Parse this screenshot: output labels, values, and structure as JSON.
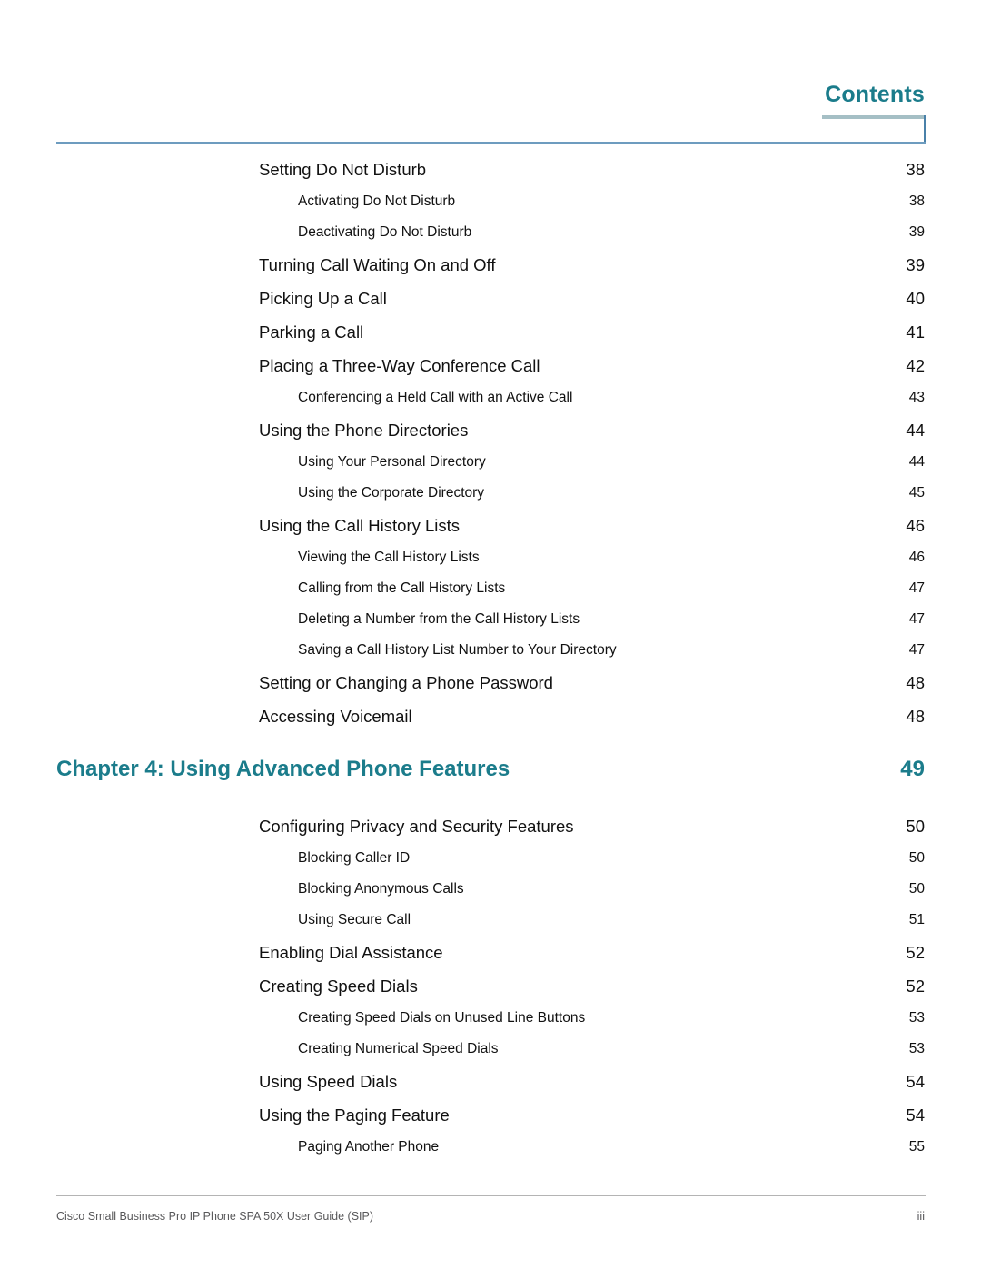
{
  "header": {
    "title": "Contents",
    "accent_color": "#1b7c8b",
    "rule_color": "#6d9cbf",
    "underline_color": "#a5bfc5"
  },
  "toc": {
    "entries": [
      {
        "level": 1,
        "label": "Setting Do Not Disturb",
        "page": "38"
      },
      {
        "level": 2,
        "label": "Activating Do Not Disturb",
        "page": "38"
      },
      {
        "level": 2,
        "label": "Deactivating Do Not Disturb",
        "page": "39"
      },
      {
        "level": 1,
        "label": "Turning Call Waiting On and Off",
        "page": "39"
      },
      {
        "level": 1,
        "label": "Picking Up a Call",
        "page": "40"
      },
      {
        "level": 1,
        "label": "Parking a Call",
        "page": "41"
      },
      {
        "level": 1,
        "label": "Placing a Three-Way Conference Call",
        "page": "42"
      },
      {
        "level": 2,
        "label": "Conferencing a Held Call with an Active Call",
        "page": "43"
      },
      {
        "level": 1,
        "label": "Using the Phone Directories",
        "page": "44"
      },
      {
        "level": 2,
        "label": "Using Your Personal Directory",
        "page": "44"
      },
      {
        "level": 2,
        "label": "Using the Corporate Directory",
        "page": "45"
      },
      {
        "level": 1,
        "label": "Using the Call History Lists",
        "page": "46"
      },
      {
        "level": 2,
        "label": "Viewing the Call History Lists",
        "page": "46"
      },
      {
        "level": 2,
        "label": "Calling from the Call History Lists",
        "page": "47"
      },
      {
        "level": 2,
        "label": "Deleting a Number from the Call History Lists",
        "page": "47"
      },
      {
        "level": 2,
        "label": "Saving a Call History List Number to Your Directory",
        "page": "47"
      },
      {
        "level": 1,
        "label": "Setting or Changing a Phone Password",
        "page": "48"
      },
      {
        "level": 1,
        "label": "Accessing Voicemail",
        "page": "48"
      },
      {
        "level": "chapter",
        "label": "Chapter 4: Using Advanced Phone Features",
        "page": "49"
      },
      {
        "level": 1,
        "label": "Configuring Privacy and Security Features",
        "page": "50"
      },
      {
        "level": 2,
        "label": "Blocking Caller ID",
        "page": "50"
      },
      {
        "level": 2,
        "label": "Blocking Anonymous Calls",
        "page": "50"
      },
      {
        "level": 2,
        "label": "Using Secure Call",
        "page": "51"
      },
      {
        "level": 1,
        "label": "Enabling Dial Assistance",
        "page": "52"
      },
      {
        "level": 1,
        "label": "Creating Speed Dials",
        "page": "52"
      },
      {
        "level": 2,
        "label": "Creating Speed Dials on Unused Line Buttons",
        "page": "53"
      },
      {
        "level": 2,
        "label": "Creating Numerical Speed Dials",
        "page": "53"
      },
      {
        "level": 1,
        "label": "Using Speed Dials",
        "page": "54"
      },
      {
        "level": 1,
        "label": "Using the Paging Feature",
        "page": "54"
      },
      {
        "level": 2,
        "label": "Paging Another Phone",
        "page": "55"
      }
    ]
  },
  "footer": {
    "document_title": "Cisco Small Business Pro IP Phone SPA 50X User Guide (SIP)",
    "page_number": "iii"
  }
}
